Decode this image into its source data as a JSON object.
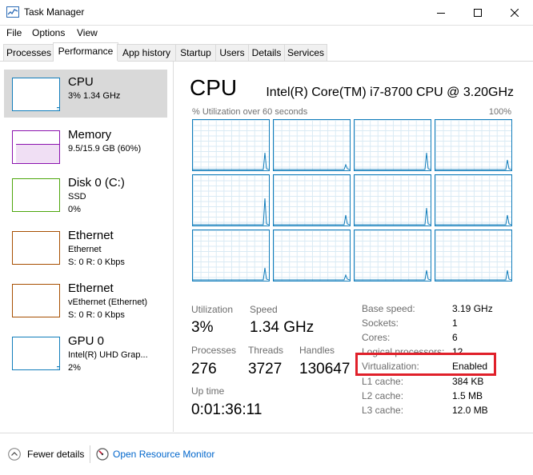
{
  "window": {
    "title": "Task Manager"
  },
  "menu": [
    "File",
    "Options",
    "View"
  ],
  "tabs": [
    "Processes",
    "Performance",
    "App history",
    "Startup",
    "Users",
    "Details",
    "Services"
  ],
  "active_tab": "Performance",
  "sidebar": {
    "items": [
      {
        "name": "CPU",
        "line1": "3%  1.34 GHz",
        "line2": "",
        "color": "#117dbb",
        "level": 0.03
      },
      {
        "name": "Memory",
        "line1": "9.5/15.9 GB (60%)",
        "line2": "",
        "color": "#8b12ae",
        "level": 0.6
      },
      {
        "name": "Disk 0 (C:)",
        "line1": "SSD",
        "line2": "0%",
        "color": "#4da60c",
        "level": 0
      },
      {
        "name": "Ethernet",
        "line1": "Ethernet",
        "line2": "S: 0  R: 0 Kbps",
        "color": "#a74f01",
        "level": 0
      },
      {
        "name": "Ethernet",
        "line1": "vEthernet (Ethernet)",
        "line2": "S: 0  R: 0 Kbps",
        "color": "#a74f01",
        "level": 0
      },
      {
        "name": "GPU 0",
        "line1": "Intel(R) UHD Grap...",
        "line2": "2%",
        "color": "#117dbb",
        "level": 0.02
      }
    ]
  },
  "main": {
    "title": "CPU",
    "model": "Intel(R) Core(TM) i7-8700 CPU @ 3.20GHz",
    "graph_label": "% Utilization over 60 seconds",
    "graph_max": "100%",
    "stats": {
      "utilization_label": "Utilization",
      "utilization": "3%",
      "speed_label": "Speed",
      "speed": "1.34 GHz",
      "processes_label": "Processes",
      "processes": "276",
      "threads_label": "Threads",
      "threads": "3727",
      "handles_label": "Handles",
      "handles": "130647",
      "uptime_label": "Up time",
      "uptime": "0:01:36:11"
    },
    "details": [
      {
        "label": "Base speed:",
        "value": "3.19 GHz"
      },
      {
        "label": "Sockets:",
        "value": "1"
      },
      {
        "label": "Cores:",
        "value": "6"
      },
      {
        "label": "Logical processors:",
        "value": "12"
      },
      {
        "label": "Virtualization:",
        "value": "Enabled"
      },
      {
        "label": "L1 cache:",
        "value": "384 KB"
      },
      {
        "label": "L2 cache:",
        "value": "1.5 MB"
      },
      {
        "label": "L3 cache:",
        "value": "12.0 MB"
      }
    ]
  },
  "bottom": {
    "fewer_details": "Fewer details",
    "resource_monitor": "Open Resource Monitor"
  },
  "colors": {
    "accent": "#117dbb",
    "highlight": "#e0202a",
    "link": "#0066cc"
  }
}
